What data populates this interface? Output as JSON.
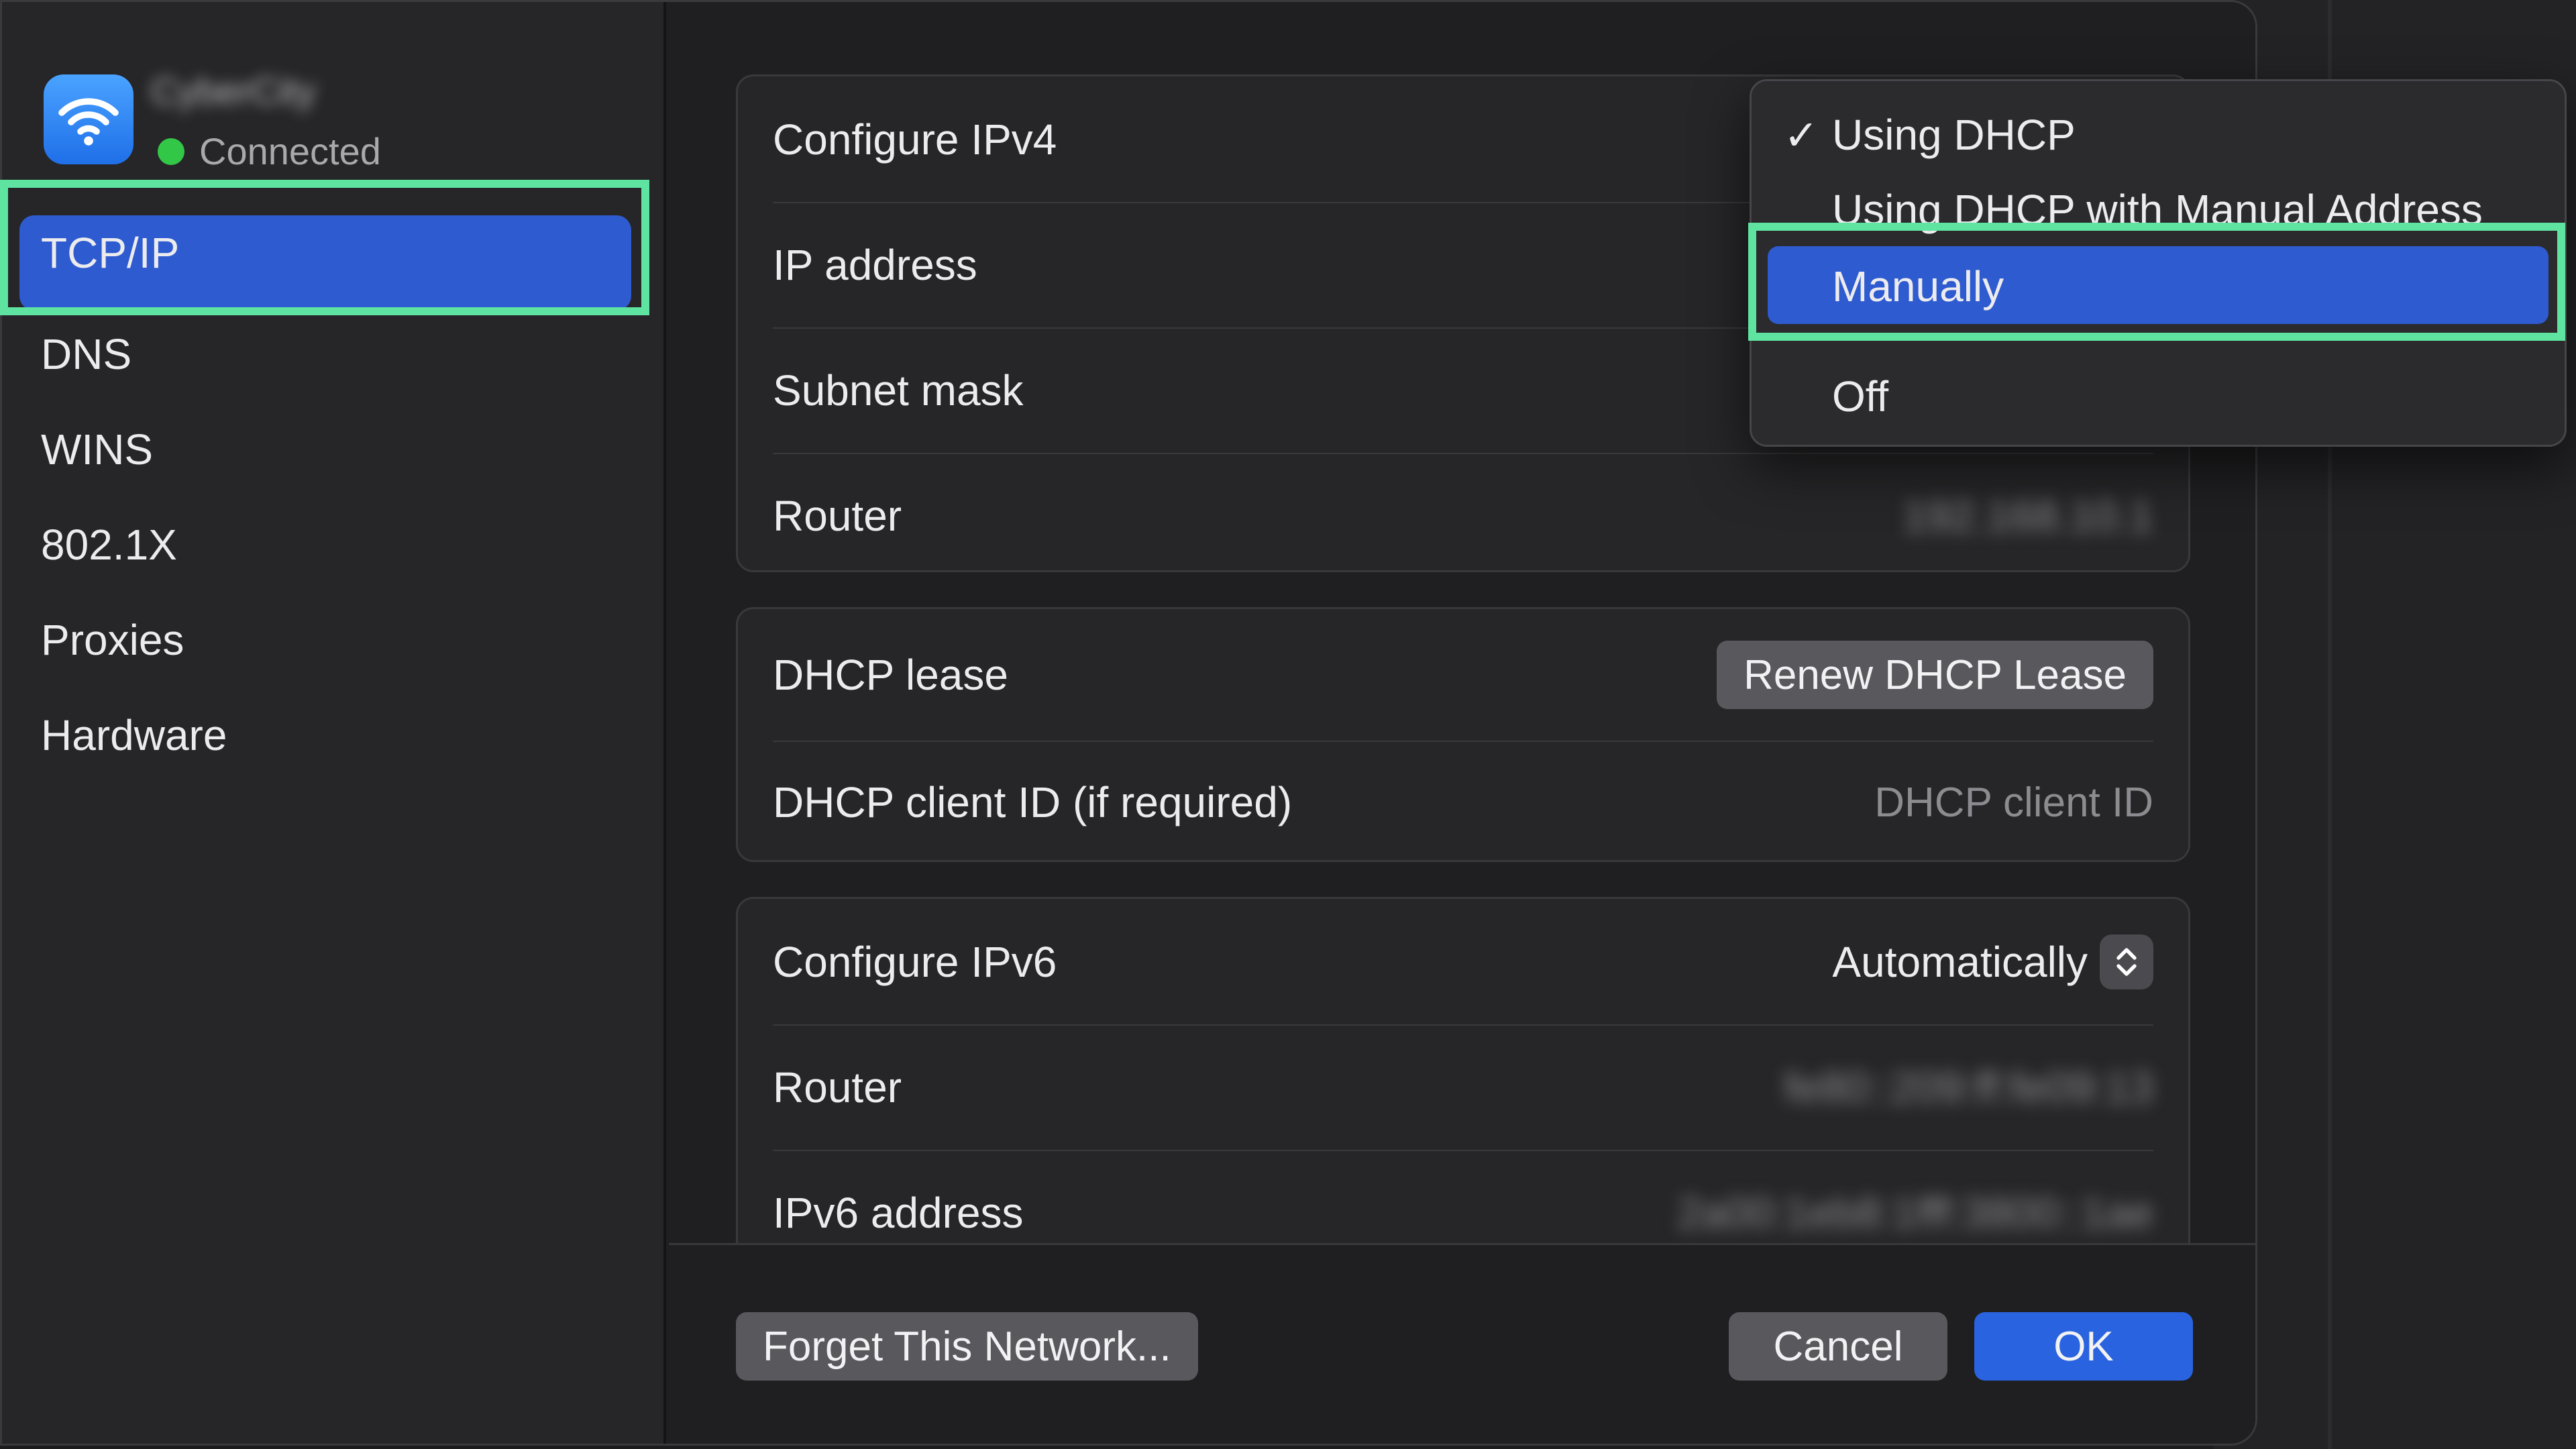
{
  "background": {
    "window_color": "#232326"
  },
  "sidebar": {
    "network_name": "CyberCity",
    "status": "Connected",
    "items": [
      {
        "label": "TCP/IP",
        "active": true
      },
      {
        "label": "DNS"
      },
      {
        "label": "WINS"
      },
      {
        "label": "802.1X"
      },
      {
        "label": "Proxies"
      },
      {
        "label": "Hardware"
      }
    ]
  },
  "ipv4": {
    "configure_label": "Configure IPv4",
    "ip_address_label": "IP address",
    "subnet_mask_label": "Subnet mask",
    "router_label": "Router",
    "router_value": "192.168.10.1"
  },
  "dhcp": {
    "lease_label": "DHCP lease",
    "renew_button": "Renew DHCP Lease",
    "client_id_label": "DHCP client ID (if required)",
    "client_id_placeholder": "DHCP client ID"
  },
  "ipv6": {
    "configure_label": "Configure IPv6",
    "configure_value": "Automatically",
    "router_label": "Router",
    "router_value": "fe80::209:ff:fe09:13",
    "address_label": "IPv6 address",
    "address_value": "2a00:1eb8:1fff:3800::1ae"
  },
  "menu": {
    "options": [
      {
        "label": "Using DHCP",
        "checked": true
      },
      {
        "label": "Using DHCP with Manual Address"
      },
      {
        "label": "Manually",
        "highlighted": true
      },
      {
        "label": "Off"
      }
    ]
  },
  "footer": {
    "forget_button": "Forget This Network...",
    "cancel_button": "Cancel",
    "ok_button": "OK"
  },
  "colors": {
    "accent": "#2e5bd0",
    "highlight_outline": "#5fe3a1",
    "connected": "#33c748"
  }
}
